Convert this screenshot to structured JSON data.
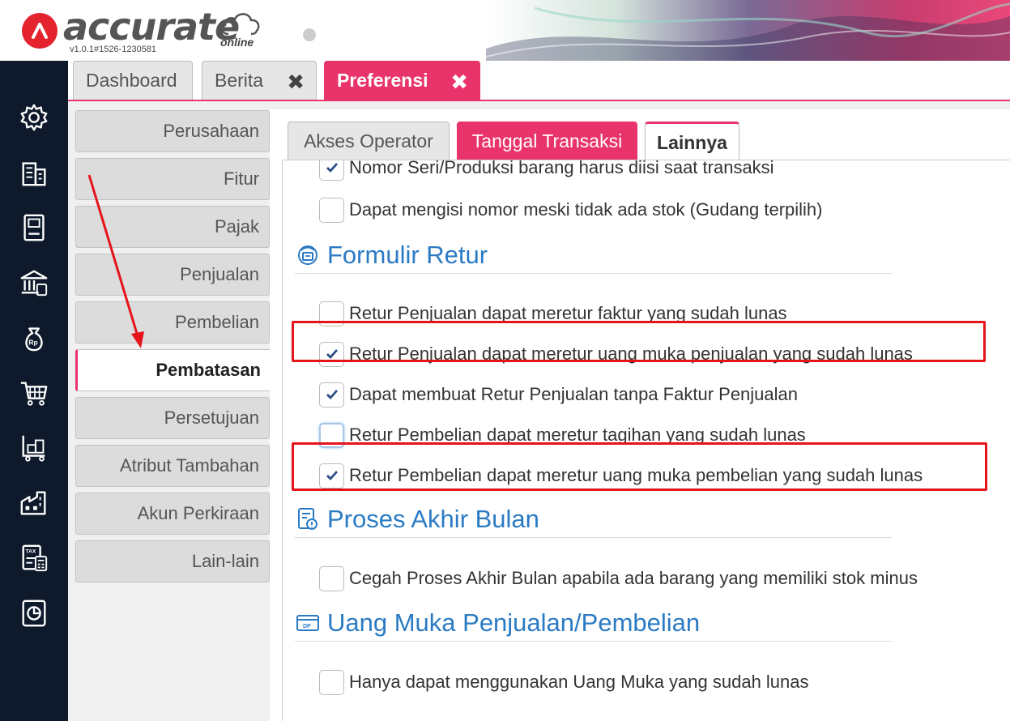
{
  "app": {
    "logo_text": "accurate",
    "logo_sub": "online",
    "version": "v1.0.1#1526-1230581"
  },
  "main_tabs": [
    {
      "label": "Dashboard",
      "closable": false,
      "active": false
    },
    {
      "label": "Berita",
      "closable": true,
      "active": false
    },
    {
      "label": "Preferensi",
      "closable": true,
      "active": true
    }
  ],
  "close_glyph": "✖",
  "left_nav_icons": [
    "settings-icon",
    "building-icon",
    "ledger-icon",
    "bank-icon",
    "money-bag-icon",
    "cart-icon",
    "inventory-icon",
    "factory-icon",
    "tax-icon",
    "report-icon"
  ],
  "sidebar": {
    "items": [
      "Perusahaan",
      "Fitur",
      "Pajak",
      "Penjualan",
      "Pembelian",
      "Pembatasan",
      "Persetujuan",
      "Atribut Tambahan",
      "Akun Perkiraan",
      "Lain-lain"
    ],
    "active": "Pembatasan"
  },
  "sub_tabs": [
    {
      "label": "Akses Operator",
      "style": "normal"
    },
    {
      "label": "Tanggal Transaksi",
      "style": "pink"
    },
    {
      "label": "Lainnya",
      "style": "active"
    }
  ],
  "options_top": [
    {
      "label": "Nomor Seri/Produksi barang harus diisi saat transaksi",
      "checked": true
    },
    {
      "label": "Dapat mengisi nomor meski tidak ada stok (Gudang terpilih)",
      "checked": false
    }
  ],
  "sections": [
    {
      "title": "Formulir Retur",
      "icon": "return-form-icon",
      "options": [
        {
          "label": "Retur Penjualan dapat meretur faktur yang sudah lunas",
          "checked": false,
          "highlighted": false
        },
        {
          "label": "Retur Penjualan dapat meretur uang muka penjualan yang sudah lunas",
          "checked": true,
          "highlighted": true
        },
        {
          "label": "Dapat membuat Retur Penjualan tanpa Faktur Penjualan",
          "checked": true,
          "highlighted": false
        },
        {
          "label": "Retur Pembelian dapat meretur tagihan yang sudah lunas",
          "checked": false,
          "highlighted": false,
          "focused": true
        },
        {
          "label": "Retur Pembelian dapat meretur uang muka pembelian yang sudah lunas",
          "checked": true,
          "highlighted": true
        }
      ]
    },
    {
      "title": "Proses Akhir Bulan",
      "icon": "month-end-icon",
      "options": [
        {
          "label": "Cegah Proses Akhir Bulan apabila ada barang yang memiliki stok minus",
          "checked": false
        }
      ]
    },
    {
      "title": "Uang Muka Penjualan/Pembelian",
      "icon": "down-payment-icon",
      "options": [
        {
          "label": "Hanya dapat menggunakan Uang Muka yang sudah lunas",
          "checked": false
        }
      ]
    }
  ],
  "colors": {
    "brand_red": "#e4232f",
    "accent_pink": "#e8336b",
    "section_blue": "#2b7bc4",
    "check_blue": "#2a4e85",
    "nav_bg": "#0e1a2b",
    "annotation_red": "#e5141b"
  }
}
